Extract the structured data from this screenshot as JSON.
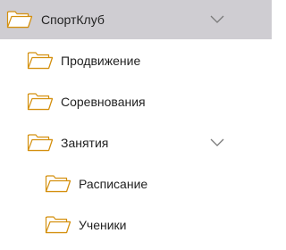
{
  "colors": {
    "selected_background": "#cfcdd2",
    "folder_stroke": "#d4900f",
    "folder_fill": "#ffffff",
    "text": "#222222",
    "chevron": "#7a7a7a"
  },
  "icons": {
    "folder": "folder-icon",
    "expand": "chevron-down-icon"
  },
  "tree": {
    "root": {
      "label": "СпортКлуб",
      "expanded": true,
      "selected": true
    },
    "items": [
      {
        "label": "Продвижение"
      },
      {
        "label": "Соревнования"
      },
      {
        "label": "Занятия",
        "expanded": true,
        "children": [
          {
            "label": "Расписание"
          },
          {
            "label": "Ученики"
          }
        ]
      }
    ]
  }
}
